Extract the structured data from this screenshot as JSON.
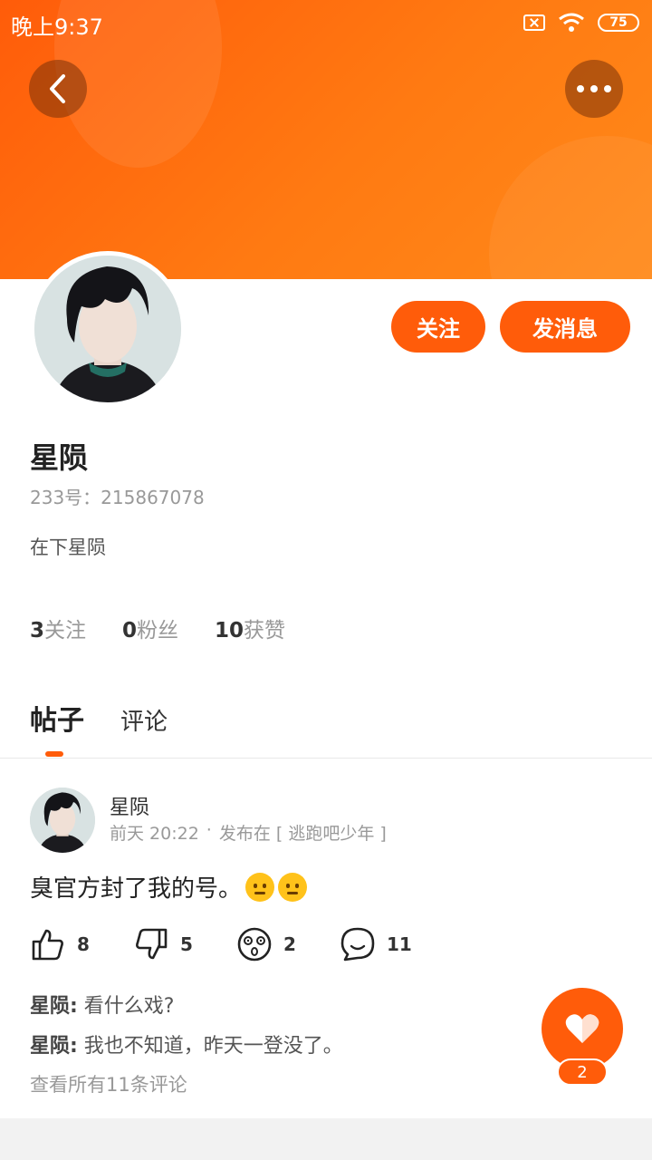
{
  "status_bar": {
    "time": "晚上9:37",
    "battery": "75"
  },
  "header": {
    "back_icon": "chevron-left-icon",
    "more_icon": "more-dots-icon"
  },
  "profile": {
    "name": "星陨",
    "uid": "233号：215867078",
    "bio": "在下星陨",
    "follow_label": "关注",
    "message_label": "发消息",
    "stats": [
      {
        "value": "3",
        "label": "关注"
      },
      {
        "value": "0",
        "label": "粉丝"
      },
      {
        "value": "10",
        "label": "获赞"
      }
    ]
  },
  "tabs": [
    {
      "label": "帖子",
      "active": true
    },
    {
      "label": "评论",
      "active": false
    }
  ],
  "post": {
    "author": "星陨",
    "time": "前天 20:22",
    "separator": "·",
    "posted_in": "发布在 [ 逃跑吧少年 ]",
    "text": "臭官方封了我的号。",
    "actions": {
      "like": "8",
      "dislike": "5",
      "dizzy": "2",
      "comment": "11"
    },
    "comments": [
      {
        "author": "星陨:",
        "text": " 看什么戏?"
      },
      {
        "author": "星陨:",
        "text": " 我也不知道，昨天一登没了。"
      }
    ],
    "view_all": "查看所有11条评论"
  },
  "fab": {
    "icon": "heart-icon",
    "count": "2"
  },
  "colors": {
    "accent": "#ff5c0a",
    "banner_end": "#ff8a1a"
  }
}
